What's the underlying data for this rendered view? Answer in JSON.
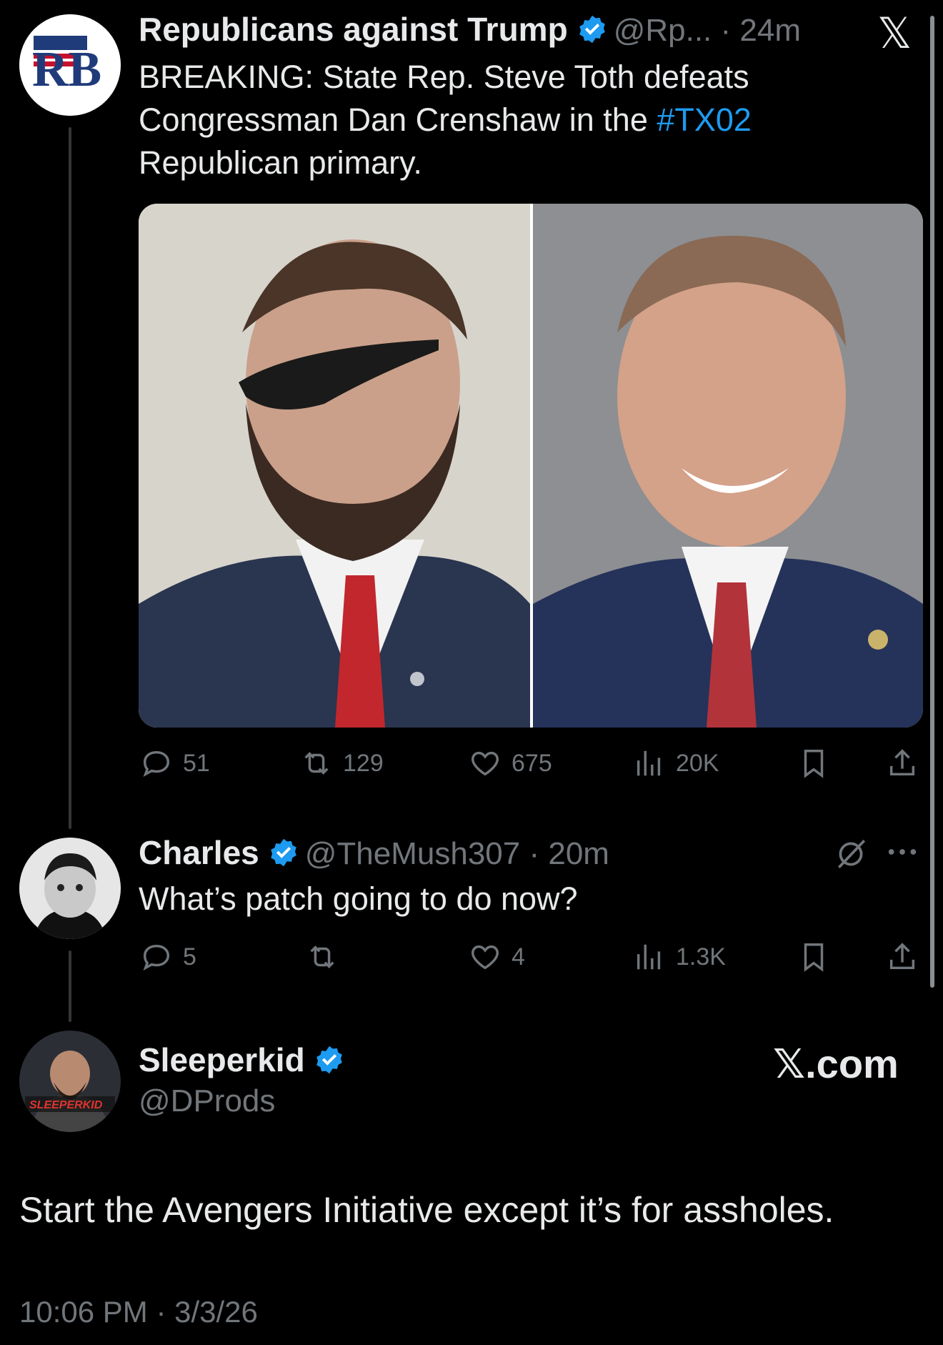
{
  "tweet1": {
    "name": "Republicans against Trump",
    "handle_time": "@Rp... · 24m",
    "text_part1": "BREAKING: State Rep. Steve Toth defeats Congressman Dan Crenshaw in the ",
    "hashtag": "#TX02",
    "text_part2": " Republican primary.",
    "replies": "51",
    "reposts": "129",
    "likes": "675",
    "views": "20K",
    "avatar_letters": "RB"
  },
  "tweet2": {
    "name": "Charles",
    "handle": "@TheMush307",
    "time": " · 20m",
    "text": "What’s patch going to do now?",
    "replies": "5",
    "likes": "4",
    "views": "1.3K"
  },
  "quote": {
    "name": "Sleeperkid",
    "handle": "@DProds",
    "brand": "𝕏.com",
    "text": "Start the Avengers Initiative except it’s for assholes.",
    "timestamp": "10:06 PM · 3/3/26",
    "avatar_label": "SLEEPERKID"
  },
  "close_icon": "𝕏",
  "colors": {
    "accent": "#1d9bf0",
    "muted": "#71767b",
    "background": "#000000"
  }
}
